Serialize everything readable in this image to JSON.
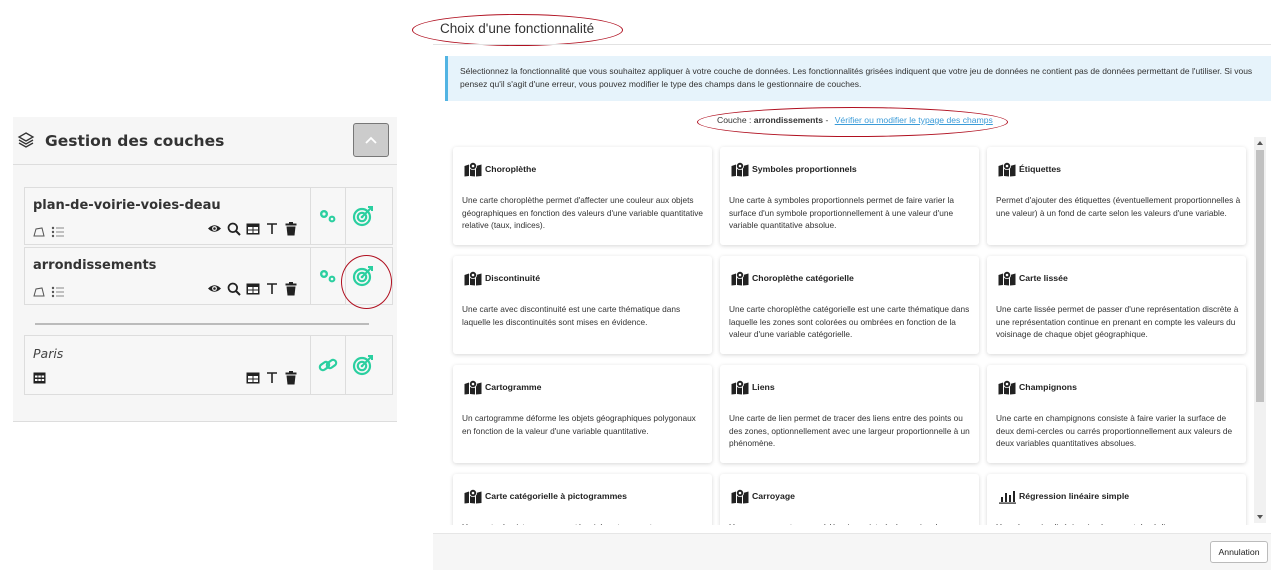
{
  "layers_panel": {
    "title": "Gestion des couches",
    "layers": [
      {
        "name": "plan-de-voirie-voies-deau"
      },
      {
        "name": "arrondissements"
      }
    ],
    "basemap": {
      "name": "Paris"
    }
  },
  "modal": {
    "title": "Choix d'une fonctionnalité",
    "info_text": "Sélectionnez la fonctionnalité que vous souhaitez appliquer à votre couche de données. Les fonctionnalités grisées indiquent que votre jeu de données ne contient pas de données permettant de l'utiliser. Si vous pensez qu'il s'agit d'une erreur, vous pouvez modifier le type des champs dans le gestionnaire de couches.",
    "layer_prefix": "Couche : ",
    "layer_name": "arrondissements",
    "layer_separator": " - ",
    "verify_link": "Vérifier ou modifier le typage des champs",
    "cards": [
      {
        "title": "Choroplèthe",
        "icon": "map-icon",
        "desc": "Une carte choroplèthe permet d'affecter une couleur aux objets géographiques en fonction des valeurs d'une variable quantitative relative (taux, indices)."
      },
      {
        "title": "Symboles proportionnels",
        "icon": "map-icon",
        "desc": "Une carte à symboles proportionnels permet de faire varier la surface d'un symbole proportionnellement à une valeur d'une variable quantitative absolue."
      },
      {
        "title": "Étiquettes",
        "icon": "map-icon",
        "desc": "Permet d'ajouter des étiquettes (éventuellement proportionnelles à une valeur) à un fond de carte selon les valeurs d'une variable."
      },
      {
        "title": "Discontinuité",
        "icon": "map-icon",
        "desc": "Une carte avec discontinuité est une carte thématique dans laquelle les discontinuités sont mises en évidence."
      },
      {
        "title": "Choroplèthe catégorielle",
        "icon": "map-icon",
        "desc": "Une carte choroplèthe catégorielle est une carte thématique dans laquelle les zones sont colorées ou ombrées en fonction de la valeur d'une variable catégorielle."
      },
      {
        "title": "Carte lissée",
        "icon": "map-icon",
        "desc": "Une carte lissée permet de passer d'une représentation discrète à une représentation continue en prenant en compte les valeurs du voisinage de chaque objet géographique."
      },
      {
        "title": "Cartogramme",
        "icon": "map-icon",
        "desc": "Un cartogramme déforme les objets géographiques polygonaux en fonction de la valeur d'une variable quantitative."
      },
      {
        "title": "Liens",
        "icon": "map-icon",
        "desc": "Une carte de lien permet de tracer des liens entre des points ou des zones, optionnellement avec une largeur proportionnelle à un phénomène."
      },
      {
        "title": "Champignons",
        "icon": "map-icon",
        "desc": "Une carte en champignons consiste à faire varier la surface de deux demi-cercles ou carrés proportionnellement aux valeurs de deux variables quantitatives absolues."
      },
      {
        "title": "Carte catégorielle à pictogrammes",
        "icon": "map-icon",
        "desc": "Une carte de pictogrammes catégoriels est une carte"
      },
      {
        "title": "Carroyage",
        "icon": "map-icon",
        "desc": "Un carroyage est un procédé qui consiste à réorganiser les"
      },
      {
        "title": "Régression linéaire simple",
        "icon": "chart-icon",
        "desc": "Une régression linéaire simple permet de réaliser une"
      }
    ],
    "cancel_label": "Annulation"
  },
  "colors": {
    "accent": "#2bcfa0",
    "annotation": "#b01020",
    "info_bg": "#e6f3fb",
    "info_border": "#52b4e3",
    "link": "#3a9bd8"
  }
}
